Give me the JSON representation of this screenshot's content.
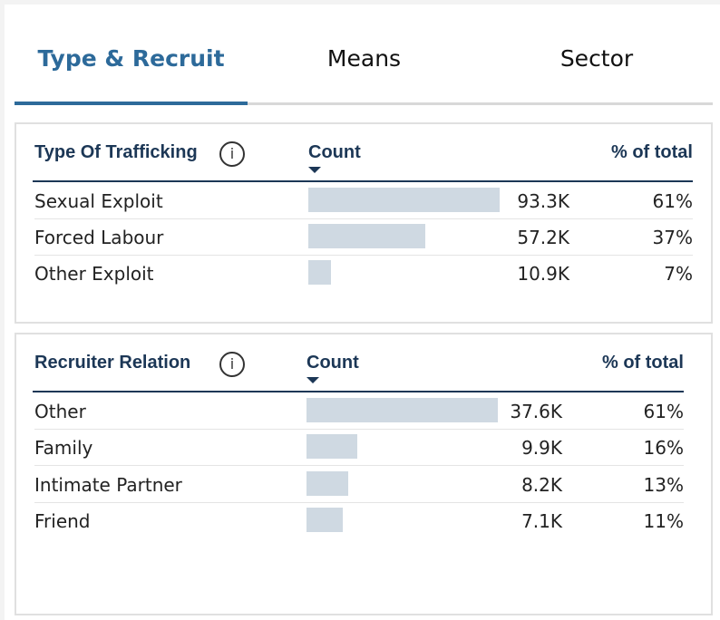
{
  "tabs": [
    {
      "label": "Type & Recruit",
      "active": true
    },
    {
      "label": "Means",
      "active": false
    },
    {
      "label": "Sector",
      "active": false
    }
  ],
  "accent_color": "#2d6a9a",
  "header_color": "#1c3756",
  "bar_color": "#cfd9e2",
  "info_icon": "info-circle-icon",
  "sort_icon": "sort-descending-icon",
  "trafficking": {
    "title": "Type Of Trafficking",
    "count_header": "Count",
    "pct_header": "% of total",
    "max_count": 93.3,
    "rows": [
      {
        "label": "Sexual Exploit",
        "count": "93.3K",
        "count_value": 93.3,
        "pct": "61%"
      },
      {
        "label": "Forced Labour",
        "count": "57.2K",
        "count_value": 57.2,
        "pct": "37%"
      },
      {
        "label": "Other Exploit",
        "count": "10.9K",
        "count_value": 10.9,
        "pct": "7%"
      }
    ]
  },
  "recruiter": {
    "title": "Recruiter Relation",
    "count_header": "Count",
    "pct_header": "% of total",
    "max_count": 37.6,
    "rows": [
      {
        "label": "Other",
        "count": "37.6K",
        "count_value": 37.6,
        "pct": "61%"
      },
      {
        "label": "Family",
        "count": "9.9K",
        "count_value": 9.9,
        "pct": "16%"
      },
      {
        "label": "Intimate Partner",
        "count": "8.2K",
        "count_value": 8.2,
        "pct": "13%"
      },
      {
        "label": "Friend",
        "count": "7.1K",
        "count_value": 7.1,
        "pct": "11%"
      }
    ]
  }
}
